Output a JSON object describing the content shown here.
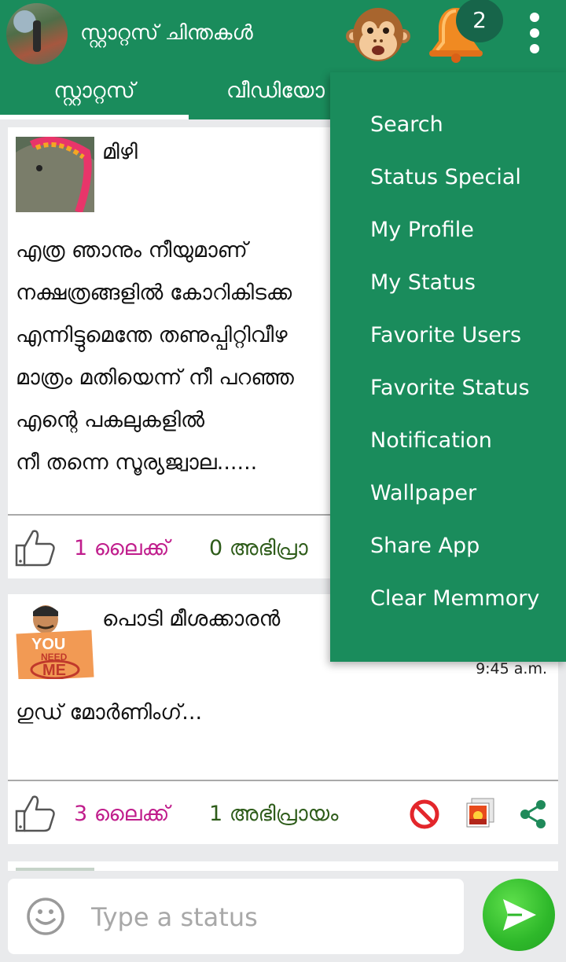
{
  "header": {
    "title": "സ്റ്റാറ്റസ് ചിന്തകൾ",
    "notification_count": "2"
  },
  "tabs": [
    {
      "label": "സ്റ്റാറ്റസ്"
    },
    {
      "label": "വീഡിയോ"
    }
  ],
  "posts": [
    {
      "user": "മിഴി",
      "text": "എത്ര ഞാനും നീയുമാണ്\nനക്ഷത്രങ്ങളിൽ കോറികിടക്ക\nഎന്നിട്ടുമെന്തേ തണുപ്പിറ്റിവീഴ\nമാത്രം മതിയെന്ന് നീ പറഞ്ഞ\nഎന്റെ പകലുകളിൽ\nനീ തന്നെ സൂര്യജ്വാല......",
      "likes": "1 ലൈക്ക്",
      "comments": "0 അഭിപ്രാ"
    },
    {
      "user": "പൊടി മീശക്കാരൻ",
      "time": "9:45 a.m.",
      "text": "ഗുഡ് മോർണിംഗ്...",
      "likes": "3 ലൈക്ക്",
      "comments": "1 അഭിപ്രായം",
      "avatar_sign": {
        "line1": "YOU",
        "line2": "NEED",
        "line3": "ME"
      }
    }
  ],
  "composer": {
    "placeholder": "Type a status"
  },
  "menu": {
    "items": [
      "Search",
      "Status Special",
      "My Profile",
      "My Status",
      "Favorite Users",
      "Favorite Status",
      "Notification",
      "Wallpaper",
      "Share App",
      "Clear Memmory"
    ]
  },
  "colors": {
    "primary": "#1a8c5c",
    "like": "#c01d8c",
    "comment": "#2e5c1a",
    "send": "#2eb82a"
  }
}
